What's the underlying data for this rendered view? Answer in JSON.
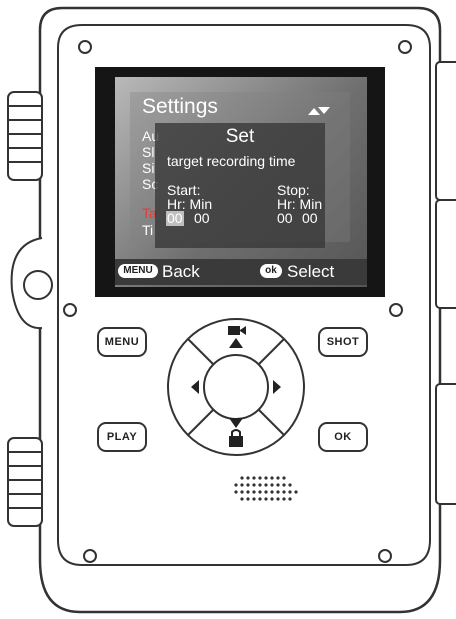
{
  "screen": {
    "menu_title": "Settings",
    "menu_items": [
      {
        "label": "Au",
        "selected": false
      },
      {
        "label": "Sl",
        "selected": false
      },
      {
        "label": "Si",
        "selected": false
      },
      {
        "label": "Sc",
        "selected": false
      },
      {
        "label": "Ta",
        "selected": true
      },
      {
        "label": "Ti",
        "selected": false
      }
    ],
    "dialog": {
      "title": "Set",
      "subtitle": "target recording time",
      "start_label": "Start:",
      "stop_label": "Stop:",
      "start_units": "Hr: Min",
      "stop_units": "Hr: Min",
      "start_hour": "00",
      "start_min": "00",
      "stop_hour": "00",
      "stop_min": "00"
    },
    "softkeys": {
      "left_key": "MENU",
      "left_label": "Back",
      "right_key": "ok",
      "right_label": "Select"
    },
    "colors": {
      "selected_item": "#e23b3b"
    }
  },
  "buttons": {
    "menu": "MENU",
    "shot": "SHOT",
    "play": "PLAY",
    "ok": "OK"
  },
  "dpad": {
    "up_icon": "video-camera-icon",
    "down_icon": "lock-icon"
  }
}
